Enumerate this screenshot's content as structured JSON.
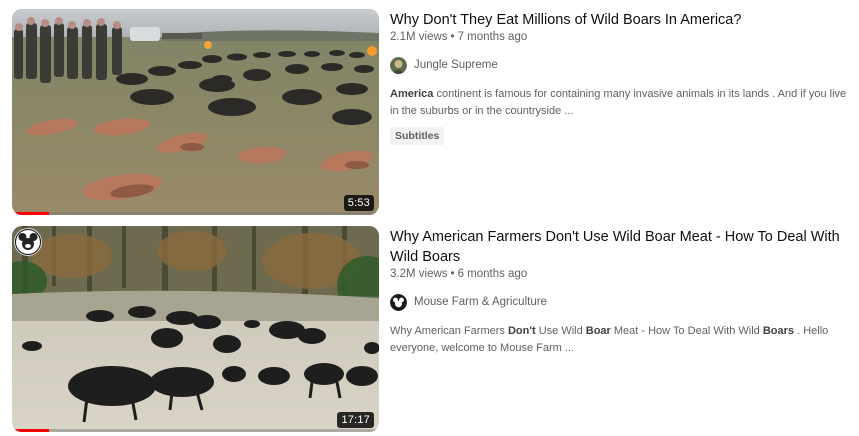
{
  "results": [
    {
      "title": "Why Don't They Eat Millions of Wild Boars In America?",
      "views": "2.1M views",
      "age": "7 months ago",
      "channel": "Jungle Supreme",
      "snippet_parts": [
        {
          "text": "America",
          "bold": true
        },
        {
          "text": " continent is famous for containing many invasive animals in its lands . And if you live in the suburbs or in the countryside ...",
          "bold": false
        }
      ],
      "badge": "Subtitles",
      "duration": "5:53",
      "watch_progress": 0.1
    },
    {
      "title": "Why American Farmers Don't Use Wild Boar Meat - How To Deal With Wild Boars",
      "views": "3.2M views",
      "age": "6 months ago",
      "channel": "Mouse Farm & Agriculture",
      "snippet_parts": [
        {
          "text": "Why American Farmers ",
          "bold": false
        },
        {
          "text": "Don't",
          "bold": true
        },
        {
          "text": " Use Wild ",
          "bold": false
        },
        {
          "text": "Boar",
          "bold": true
        },
        {
          "text": " Meat - How To Deal With Wild ",
          "bold": false
        },
        {
          "text": "Boars",
          "bold": true
        },
        {
          "text": " . Hello everyone, welcome to Mouse Farm ...",
          "bold": false
        }
      ],
      "duration": "17:17",
      "watch_progress": 0.1
    }
  ],
  "separator": "•",
  "colors": {
    "progress": "#ff0000",
    "title": "#0f0f0f",
    "meta": "#606060"
  }
}
